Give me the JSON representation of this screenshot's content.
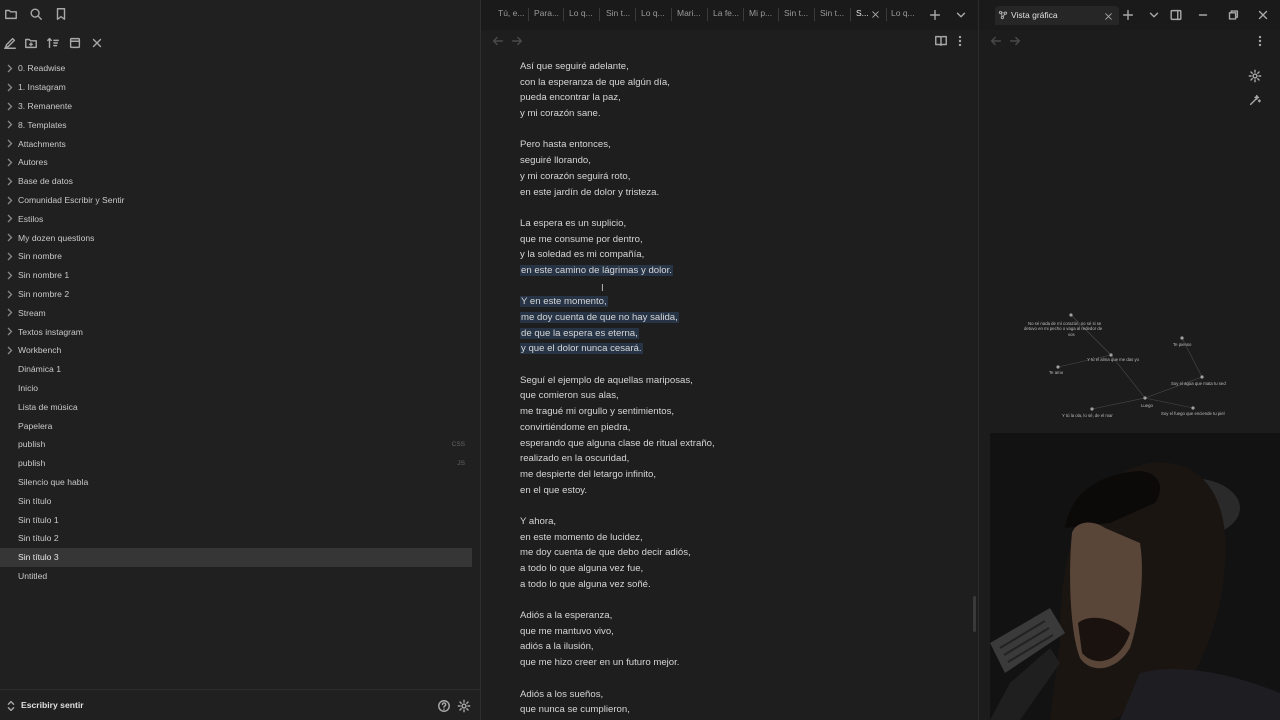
{
  "sidebar": {
    "folders": [
      {
        "label": "0. Readwise"
      },
      {
        "label": "1. Instagram"
      },
      {
        "label": "3. Remanente"
      },
      {
        "label": "8. Templates"
      },
      {
        "label": "Attachments"
      },
      {
        "label": "Autores"
      },
      {
        "label": "Base de datos"
      },
      {
        "label": "Comunidad Escribir y Sentir"
      },
      {
        "label": "Estilos"
      },
      {
        "label": "My dozen questions"
      },
      {
        "label": "Sin nombre"
      },
      {
        "label": "Sin nombre 1"
      },
      {
        "label": "Sin nombre 2"
      },
      {
        "label": "Stream"
      },
      {
        "label": "Textos instagram"
      },
      {
        "label": "Workbench"
      }
    ],
    "files": [
      {
        "label": "Dinámica 1",
        "ext": ""
      },
      {
        "label": "Inicio",
        "ext": ""
      },
      {
        "label": "Lista de música",
        "ext": ""
      },
      {
        "label": "Papelera",
        "ext": ""
      },
      {
        "label": "publish",
        "ext": "CSS"
      },
      {
        "label": "publish",
        "ext": "JS"
      },
      {
        "label": "Silencio que habla",
        "ext": ""
      },
      {
        "label": "Sin título",
        "ext": ""
      },
      {
        "label": "Sin título 1",
        "ext": ""
      },
      {
        "label": "Sin título 2",
        "ext": ""
      },
      {
        "label": "Sin título 3",
        "ext": "",
        "active": true
      },
      {
        "label": "Untitled",
        "ext": ""
      }
    ],
    "vault_name": "Escribiry sentir"
  },
  "editor": {
    "tabs": [
      {
        "label": "Tú, e..."
      },
      {
        "label": "Para..."
      },
      {
        "label": "Lo q..."
      },
      {
        "label": "Sin t..."
      },
      {
        "label": "Lo q..."
      },
      {
        "label": "Mari..."
      },
      {
        "label": "La fe..."
      },
      {
        "label": "Mi p..."
      },
      {
        "label": "Sin t..."
      },
      {
        "label": "Sin t..."
      },
      {
        "label": "S...",
        "active": true
      },
      {
        "label": "Lo q..."
      }
    ],
    "lines": [
      {
        "text": "Así que seguiré adelante,"
      },
      {
        "text": "con la esperanza de que algún día,"
      },
      {
        "text": "pueda encontrar la paz,"
      },
      {
        "text": "y mi corazón sane."
      },
      {
        "text": ""
      },
      {
        "text": "Pero hasta entonces,"
      },
      {
        "text": "seguiré llorando,"
      },
      {
        "text": "y mi corazón seguirá roto,"
      },
      {
        "text": "en este jardín de dolor y tristeza."
      },
      {
        "text": ""
      },
      {
        "text": "La espera es un suplicio,"
      },
      {
        "text": "que me consume por dentro,"
      },
      {
        "text": "y la soledad es mi compañía,"
      },
      {
        "text": "en este camino de lágrimas y dolor.",
        "hl": true
      },
      {
        "text": "",
        "hl": true
      },
      {
        "text": "Y en este momento,",
        "hl": true
      },
      {
        "text": "me doy cuenta de que no hay salida,",
        "hl": true
      },
      {
        "text": "de que la espera es eterna,",
        "hl": true
      },
      {
        "text": "y que el dolor nunca cesará.",
        "hl": true
      },
      {
        "text": ""
      },
      {
        "text": "Seguí el ejemplo de aquellas mariposas,"
      },
      {
        "text": "que comieron sus alas,"
      },
      {
        "text": "me tragué mi orgullo y sentimientos,"
      },
      {
        "text": "convirtiéndome en piedra,"
      },
      {
        "text": "esperando que alguna clase de ritual extraño,"
      },
      {
        "text": "realizado en la oscuridad,"
      },
      {
        "text": "me despierte del letargo infinito,"
      },
      {
        "text": "en el que estoy."
      },
      {
        "text": ""
      },
      {
        "text": "Y ahora,"
      },
      {
        "text": "en este momento de lucidez,"
      },
      {
        "text": "me doy cuenta de que debo decir adiós,"
      },
      {
        "text": "a todo lo que alguna vez fue,"
      },
      {
        "text": "a todo lo que alguna vez soñé."
      },
      {
        "text": ""
      },
      {
        "text": "Adiós a la esperanza,"
      },
      {
        "text": "que me mantuvo vivo,"
      },
      {
        "text": "adiós a la ilusión,"
      },
      {
        "text": "que me hizo creer en un futuro mejor."
      },
      {
        "text": ""
      },
      {
        "text": "Adiós a los sueños,"
      },
      {
        "text": "que nunca se cumplieron,"
      }
    ]
  },
  "graph": {
    "tab_label": "Vista gráfica",
    "node_labels": [
      "No sé nada de mí corazón, no sé si se",
      "detuvo en mi pecho o vaga al rededor de",
      "vos",
      "Y tú el alma que me das yo",
      "Te amo",
      "Te pienso",
      "Soy el agua que mata tu sed",
      "Y tú la ola, lo sé, de el mar",
      "Luego",
      "Soy el fuego que enciende tu piel"
    ]
  },
  "colors": {
    "accent": "#7f6df2",
    "selection": "#263446",
    "active_file": "#363636"
  }
}
